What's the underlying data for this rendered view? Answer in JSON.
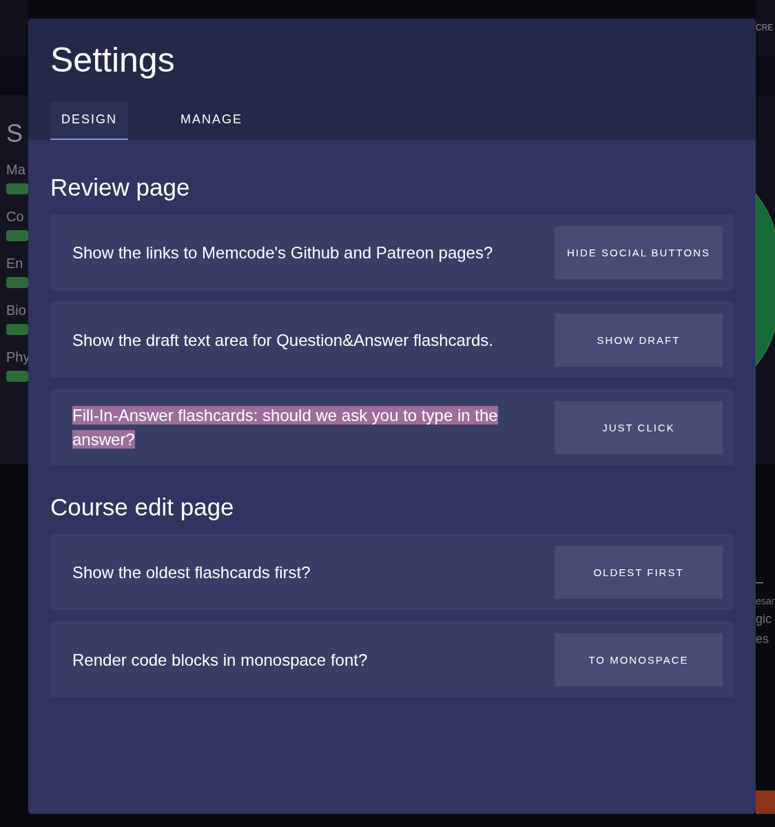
{
  "background": {
    "left_panel": {
      "title": "S",
      "items": [
        "Ma",
        "Co",
        "En",
        "Bio",
        "Phy"
      ]
    },
    "right_edge": {
      "header_text": "CRE",
      "texts": [
        "–",
        "esar",
        "gic",
        "es"
      ]
    }
  },
  "dialog": {
    "title": "Settings",
    "tabs": [
      {
        "label": "DESIGN",
        "selected": true
      },
      {
        "label": "MANAGE",
        "selected": false
      }
    ],
    "sections": [
      {
        "heading": "Review page",
        "settings": [
          {
            "question": "Show the links to Memcode's Github and Patreon pages?",
            "button": "HIDE SOCIAL BUTTONS",
            "highlighted": false
          },
          {
            "question": "Show the draft text area for Question&Answer flashcards.",
            "button": "SHOW DRAFT",
            "highlighted": false
          },
          {
            "question": "Fill-In-Answer flashcards: should we ask you to type in the answer?",
            "button": "JUST CLICK",
            "highlighted": true
          }
        ]
      },
      {
        "heading": "Course edit page",
        "settings": [
          {
            "question": "Show the oldest flashcards first?",
            "button": "OLDEST FIRST",
            "highlighted": false
          },
          {
            "question": "Render code blocks in monospace font?",
            "button": "TO MONOSPACE",
            "highlighted": false
          }
        ]
      }
    ]
  }
}
